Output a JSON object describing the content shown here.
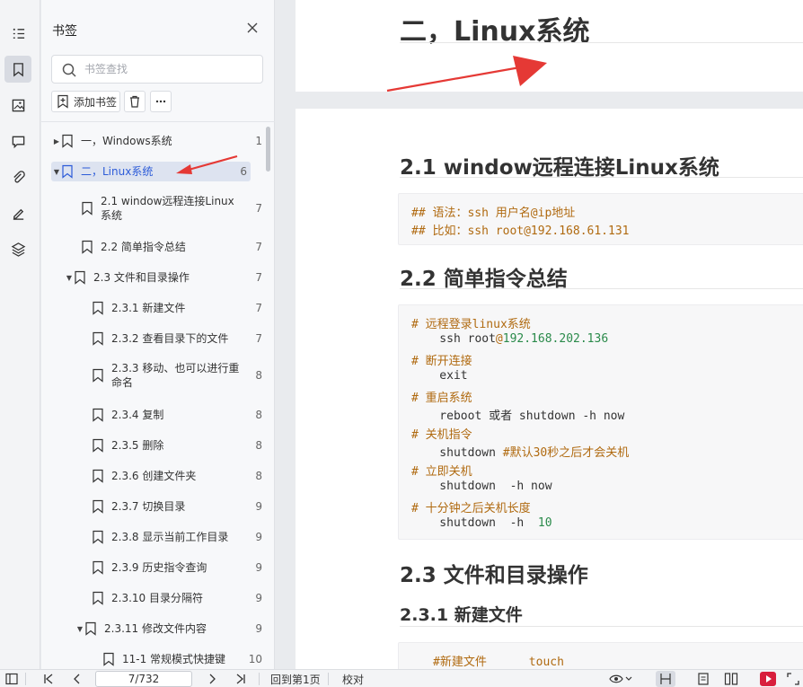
{
  "panel": {
    "title": "书签",
    "search_placeholder": "书签查找",
    "add_label": "添加书签"
  },
  "bookmarks": [
    {
      "label": "一，Windows系统",
      "page": "1",
      "twisty": "▶"
    },
    {
      "label": "二，Linux系统",
      "page": "6",
      "twisty": "▼",
      "selected": true
    },
    {
      "label": "2.1 window远程连接Linux 系统",
      "page": "7",
      "twisty": ""
    },
    {
      "label": "2.2 简单指令总结",
      "page": "7",
      "twisty": ""
    },
    {
      "label": "2.3 文件和目录操作",
      "page": "7",
      "twisty": "▼"
    },
    {
      "label": "2.3.1 新建文件",
      "page": "7",
      "twisty": ""
    },
    {
      "label": "2.3.2 查看目录下的文件",
      "page": "7",
      "twisty": ""
    },
    {
      "label": "2.3.3 移动、也可以进行重命名",
      "page": "8",
      "twisty": ""
    },
    {
      "label": "2.3.4 复制",
      "page": "8",
      "twisty": ""
    },
    {
      "label": "2.3.5 删除",
      "page": "8",
      "twisty": ""
    },
    {
      "label": "2.3.6 创建文件夹",
      "page": "8",
      "twisty": ""
    },
    {
      "label": "2.3.7 切换目录",
      "page": "9",
      "twisty": ""
    },
    {
      "label": "2.3.8 显示当前工作目录",
      "page": "9",
      "twisty": ""
    },
    {
      "label": "2.3.9 历史指令查询",
      "page": "9",
      "twisty": ""
    },
    {
      "label": "2.3.10 目录分隔符",
      "page": "9",
      "twisty": ""
    },
    {
      "label": "2.3.11 修改文件内容",
      "page": "9",
      "twisty": "▼"
    },
    {
      "label": "11-1 常规模式快捷键",
      "page": "10",
      "twisty": ""
    }
  ],
  "doc": {
    "h_linux": "二，Linux系统",
    "h_21": "2.1 window远程连接Linux系统",
    "code1": [
      [
        "## 语法：ssh 用户名@ip地址"
      ],
      [
        "## 比如：ssh root@192.168.61.131"
      ]
    ],
    "h_22": "2.2 简单指令总结",
    "code2": {
      "c1": "# 远程登录linux系统",
      "l1a": "    ssh root",
      "l1b": "@",
      "l1c": "192.168.202.136",
      "c2": "# 断开连接",
      "l2": "    exit",
      "c3": "# 重启系统",
      "l3": "    reboot 或者 shutdown -h now",
      "c4": "# 关机指令",
      "l4a": "    shutdown ",
      "l4b": "#默认30秒之后才会关机",
      "c5": "# 立即关机",
      "l5": "    shutdown  -h now",
      "c6": "# 十分钟之后关机长度",
      "l6a": "    shutdown  -h  ",
      "l6b": "10"
    },
    "h_23": "2.3 文件和目录操作",
    "h_231": "2.3.1 新建文件",
    "code3_a": "#新建文件",
    "code3_b": "touch"
  },
  "status": {
    "page_value": "7/732",
    "back_first": "回到第1页",
    "proof": "校对"
  },
  "colors": {
    "selected_text": "#2c5bd8",
    "selected_bg": "#dde3f0",
    "arrow": "#e53935",
    "accent_red": "#d81e3c"
  }
}
